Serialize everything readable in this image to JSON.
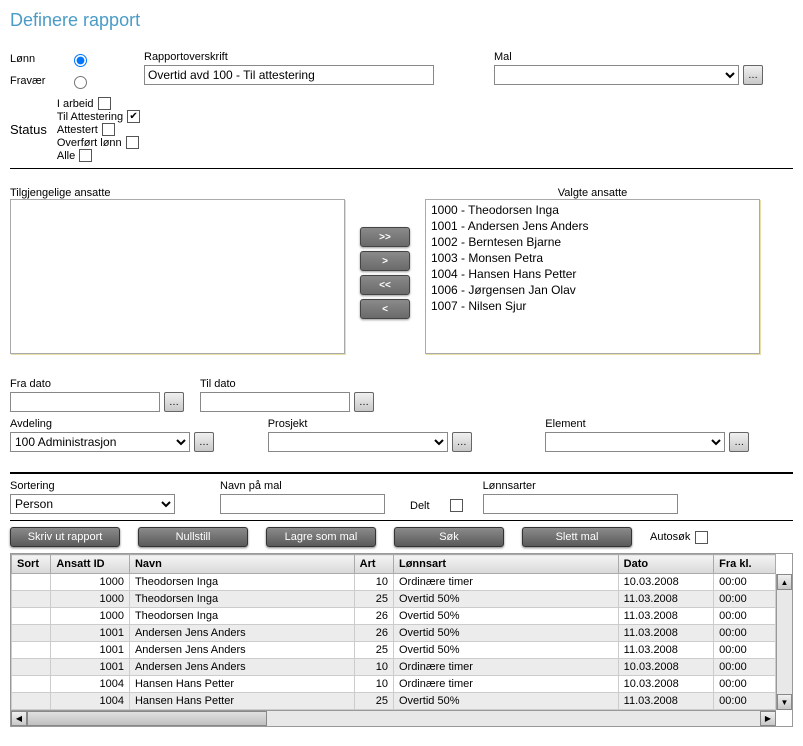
{
  "title": "Definere rapport",
  "radios": {
    "lonn": "Lønn",
    "fravaer": "Fravær",
    "selected": "lonn"
  },
  "rapportOverskrift": {
    "label": "Rapportoverskrift",
    "value": "Overtid avd 100 - Til attestering"
  },
  "mal": {
    "label": "Mal",
    "value": ""
  },
  "status": {
    "label": "Status",
    "items": [
      {
        "key": "iarbeid",
        "label": "I arbeid",
        "checked": false
      },
      {
        "key": "tilattestering",
        "label": "Til Attestering",
        "checked": true
      },
      {
        "key": "attestert",
        "label": "Attestert",
        "checked": false
      },
      {
        "key": "overfort",
        "label": "Overført lønn",
        "checked": false
      },
      {
        "key": "alle",
        "label": "Alle",
        "checked": false
      }
    ]
  },
  "available": {
    "label": "Tilgjengelige ansatte",
    "items": []
  },
  "selected": {
    "label": "Valgte ansatte",
    "items": [
      "1000 - Theodorsen Inga",
      "1001 - Andersen Jens Anders",
      "1002 - Berntesen Bjarne",
      "1003 - Monsen Petra",
      "1004 - Hansen Hans Petter",
      "1006 - Jørgensen Jan Olav",
      "1007 - Nilsen Sjur"
    ]
  },
  "transfer": {
    "addAll": ">>",
    "add": ">",
    "removeAll": "<<",
    "remove": "<"
  },
  "fraDato": {
    "label": "Fra dato",
    "value": ""
  },
  "tilDato": {
    "label": "Til dato",
    "value": ""
  },
  "avdeling": {
    "label": "Avdeling",
    "value": "100 Administrasjon"
  },
  "prosjekt": {
    "label": "Prosjekt",
    "value": ""
  },
  "element": {
    "label": "Element",
    "value": ""
  },
  "sortering": {
    "label": "Sortering",
    "value": "Person"
  },
  "navnPaMal": {
    "label": "Navn på mal",
    "value": ""
  },
  "delt": {
    "label": "Delt",
    "checked": false
  },
  "lonnsarter": {
    "label": "Lønnsarter",
    "value": ""
  },
  "actions": {
    "skrivUt": "Skriv ut rapport",
    "nullstill": "Nullstill",
    "lagreSomMal": "Lagre som mal",
    "sok": "Søk",
    "slettMal": "Slett mal",
    "autosok": "Autosøk",
    "autosokChecked": false
  },
  "grid": {
    "columns": [
      "Sort",
      "Ansatt ID",
      "Navn",
      "Art",
      "Lønnsart",
      "Dato",
      "Fra kl."
    ],
    "rows": [
      {
        "sort": "",
        "ansattId": "1000",
        "navn": "Theodorsen Inga",
        "art": "10",
        "lonnsart": "Ordinære timer",
        "dato": "10.03.2008",
        "frakl": "00:00"
      },
      {
        "sort": "",
        "ansattId": "1000",
        "navn": "Theodorsen Inga",
        "art": "25",
        "lonnsart": "Overtid 50%",
        "dato": "11.03.2008",
        "frakl": "00:00"
      },
      {
        "sort": "",
        "ansattId": "1000",
        "navn": "Theodorsen Inga",
        "art": "26",
        "lonnsart": "Overtid 50%",
        "dato": "11.03.2008",
        "frakl": "00:00"
      },
      {
        "sort": "",
        "ansattId": "1001",
        "navn": "Andersen Jens Anders",
        "art": "26",
        "lonnsart": "Overtid 50%",
        "dato": "11.03.2008",
        "frakl": "00:00"
      },
      {
        "sort": "",
        "ansattId": "1001",
        "navn": "Andersen Jens Anders",
        "art": "25",
        "lonnsart": "Overtid 50%",
        "dato": "11.03.2008",
        "frakl": "00:00"
      },
      {
        "sort": "",
        "ansattId": "1001",
        "navn": "Andersen Jens Anders",
        "art": "10",
        "lonnsart": "Ordinære timer",
        "dato": "10.03.2008",
        "frakl": "00:00"
      },
      {
        "sort": "",
        "ansattId": "1004",
        "navn": "Hansen Hans Petter",
        "art": "10",
        "lonnsart": "Ordinære timer",
        "dato": "10.03.2008",
        "frakl": "00:00"
      },
      {
        "sort": "",
        "ansattId": "1004",
        "navn": "Hansen Hans Petter",
        "art": "25",
        "lonnsart": "Overtid 50%",
        "dato": "11.03.2008",
        "frakl": "00:00"
      }
    ]
  }
}
